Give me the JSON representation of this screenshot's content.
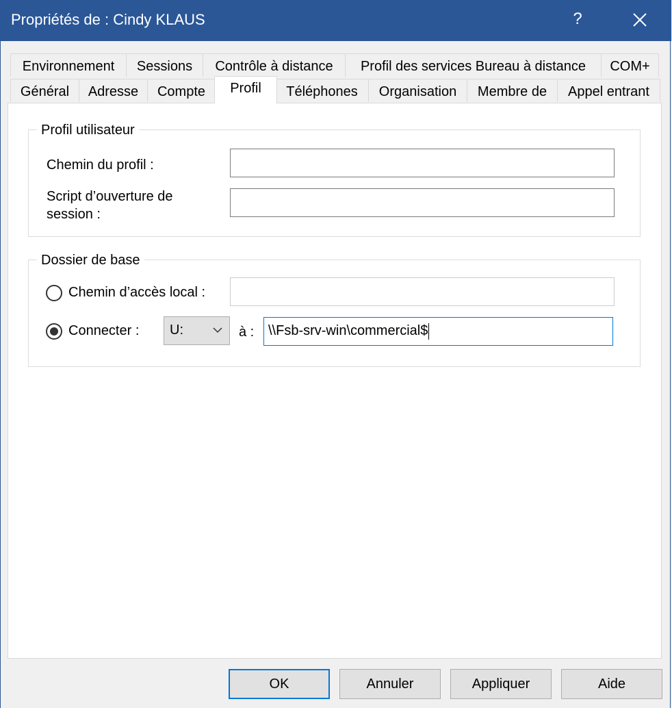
{
  "window": {
    "title": "Propriétés de : Cindy KLAUS",
    "help_label": "?"
  },
  "tabs_row1": [
    {
      "label": "Environnement"
    },
    {
      "label": "Sessions"
    },
    {
      "label": "Contrôle à distance"
    },
    {
      "label": "Profil des services Bureau à distance"
    },
    {
      "label": "COM+"
    }
  ],
  "tabs_row2": [
    {
      "label": "Général"
    },
    {
      "label": "Adresse"
    },
    {
      "label": "Compte"
    },
    {
      "label": "Profil",
      "active": true
    },
    {
      "label": "Téléphones"
    },
    {
      "label": "Organisation"
    },
    {
      "label": "Membre de"
    },
    {
      "label": "Appel entrant"
    }
  ],
  "profile_group": {
    "title": "Profil utilisateur",
    "path_label": "Chemin du profil :",
    "path_value": "",
    "script_label_line1": "Script d’ouverture de",
    "script_label_line2": "session :",
    "script_value": ""
  },
  "home_group": {
    "title": "Dossier de base",
    "local_label": "Chemin d’accès local :",
    "local_value": "",
    "local_selected": false,
    "connect_label": "Connecter :",
    "connect_selected": true,
    "drive_value": "U:",
    "to_label": "à :",
    "remote_value": "\\\\Fsb-srv-win\\commercial$"
  },
  "buttons": {
    "ok": "OK",
    "cancel": "Annuler",
    "apply": "Appliquer",
    "help": "Aide"
  },
  "colors": {
    "titlebar": "#2b5797",
    "focus": "#0078d7",
    "background": "#f0f0f0"
  }
}
